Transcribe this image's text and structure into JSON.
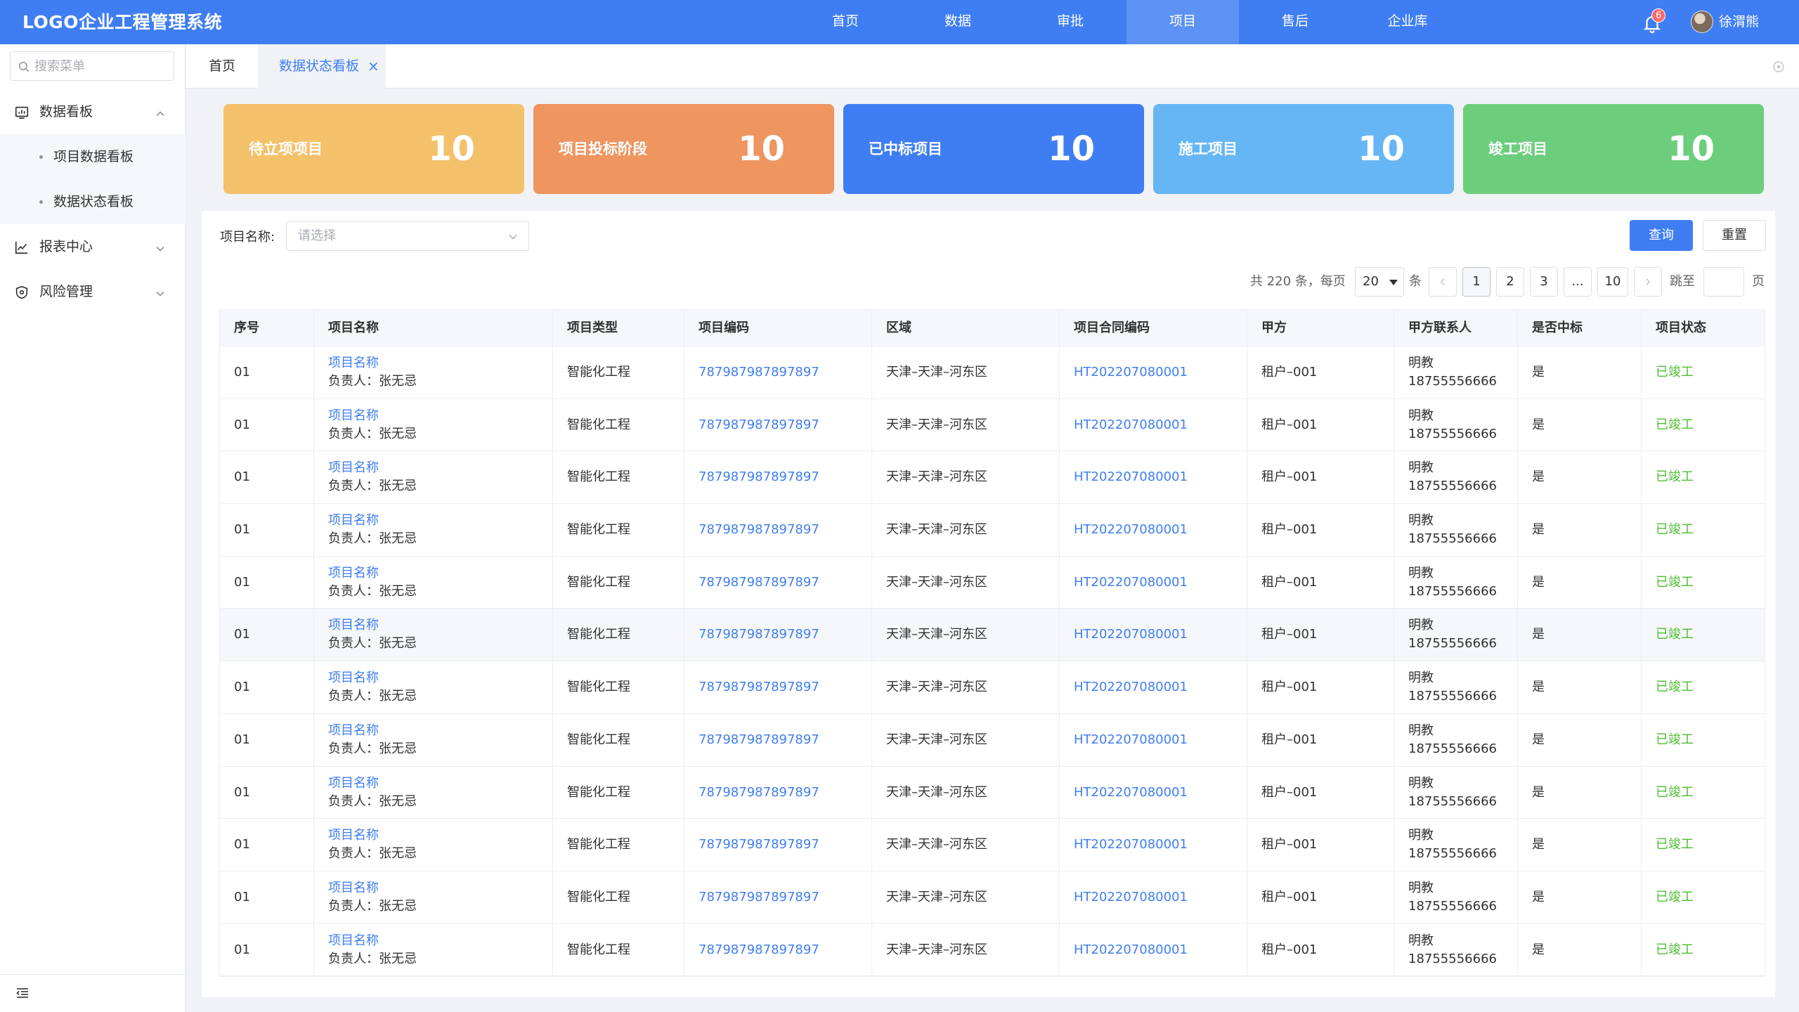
{
  "app": {
    "title": "LOGO企业工程管理系统"
  },
  "top_nav": [
    "首页",
    "数据",
    "审批",
    "项目",
    "售后",
    "企业库"
  ],
  "notifications": {
    "count": "6"
  },
  "user": {
    "name": "徐渭熊"
  },
  "sidebar": {
    "search_placeholder": "搜索菜单",
    "groups": [
      {
        "label": "数据看板",
        "icon": "dashboard-icon",
        "expanded": true,
        "children": [
          "项目数据看板",
          "数据状态看板"
        ]
      },
      {
        "label": "报表中心",
        "icon": "chart-icon",
        "expanded": false
      },
      {
        "label": "风险管理",
        "icon": "shield-icon",
        "expanded": false
      }
    ]
  },
  "tabs": {
    "home": "首页",
    "active": "数据状态看板",
    "close": "×"
  },
  "stats": [
    {
      "label": "待立项项目",
      "value": "10",
      "color": "#f4c16b"
    },
    {
      "label": "项目投标阶段",
      "value": "10",
      "color": "#ee9560"
    },
    {
      "label": "已中标项目",
      "value": "10",
      "color": "#3f7ef2"
    },
    {
      "label": "施工项目",
      "value": "10",
      "color": "#66b6f5"
    },
    {
      "label": "竣工项目",
      "value": "10",
      "color": "#6ccd7d"
    }
  ],
  "filter": {
    "label": "项目名称:",
    "placeholder": "请选择",
    "query_button": "查询",
    "reset_button": "重置"
  },
  "pagination": {
    "total_text": "共 220 条，每页",
    "page_size": "20",
    "unit": "条",
    "pages": [
      "1",
      "2",
      "3",
      "...",
      "10"
    ],
    "current_page": "1",
    "jump_label": "跳至",
    "page_label": "页"
  },
  "table": {
    "columns": [
      "序号",
      "项目名称",
      "项目类型",
      "项目编码",
      "区域",
      "项目合同编码",
      "甲方",
      "甲方联系人",
      "是否中标",
      "项目状态"
    ],
    "rows": [
      {
        "no": "01",
        "name": "项目名称",
        "owner": "负责人：张无忌",
        "type": "智能化工程",
        "code": "787987987897897",
        "region": "天津–天津–河东区",
        "contract": "HT202207080001",
        "party": "租户–001",
        "contact": "明教",
        "phone": "18755556666",
        "won": "是",
        "status": "已竣工"
      },
      {
        "no": "01",
        "name": "项目名称",
        "owner": "负责人：张无忌",
        "type": "智能化工程",
        "code": "787987987897897",
        "region": "天津–天津–河东区",
        "contract": "HT202207080001",
        "party": "租户–001",
        "contact": "明教",
        "phone": "18755556666",
        "won": "是",
        "status": "已竣工"
      },
      {
        "no": "01",
        "name": "项目名称",
        "owner": "负责人：张无忌",
        "type": "智能化工程",
        "code": "787987987897897",
        "region": "天津–天津–河东区",
        "contract": "HT202207080001",
        "party": "租户–001",
        "contact": "明教",
        "phone": "18755556666",
        "won": "是",
        "status": "已竣工"
      },
      {
        "no": "01",
        "name": "项目名称",
        "owner": "负责人：张无忌",
        "type": "智能化工程",
        "code": "787987987897897",
        "region": "天津–天津–河东区",
        "contract": "HT202207080001",
        "party": "租户–001",
        "contact": "明教",
        "phone": "18755556666",
        "won": "是",
        "status": "已竣工"
      },
      {
        "no": "01",
        "name": "项目名称",
        "owner": "负责人：张无忌",
        "type": "智能化工程",
        "code": "787987987897897",
        "region": "天津–天津–河东区",
        "contract": "HT202207080001",
        "party": "租户–001",
        "contact": "明教",
        "phone": "18755556666",
        "won": "是",
        "status": "已竣工"
      },
      {
        "no": "01",
        "name": "项目名称",
        "owner": "负责人：张无忌",
        "type": "智能化工程",
        "code": "787987987897897",
        "region": "天津–天津–河东区",
        "contract": "HT202207080001",
        "party": "租户–001",
        "contact": "明教",
        "phone": "18755556666",
        "won": "是",
        "status": "已竣工",
        "highlighted": true
      },
      {
        "no": "01",
        "name": "项目名称",
        "owner": "负责人：张无忌",
        "type": "智能化工程",
        "code": "787987987897897",
        "region": "天津–天津–河东区",
        "contract": "HT202207080001",
        "party": "租户–001",
        "contact": "明教",
        "phone": "18755556666",
        "won": "是",
        "status": "已竣工"
      },
      {
        "no": "01",
        "name": "项目名称",
        "owner": "负责人：张无忌",
        "type": "智能化工程",
        "code": "787987987897897",
        "region": "天津–天津–河东区",
        "contract": "HT202207080001",
        "party": "租户–001",
        "contact": "明教",
        "phone": "18755556666",
        "won": "是",
        "status": "已竣工"
      },
      {
        "no": "01",
        "name": "项目名称",
        "owner": "负责人：张无忌",
        "type": "智能化工程",
        "code": "787987987897897",
        "region": "天津–天津–河东区",
        "contract": "HT202207080001",
        "party": "租户–001",
        "contact": "明教",
        "phone": "18755556666",
        "won": "是",
        "status": "已竣工"
      },
      {
        "no": "01",
        "name": "项目名称",
        "owner": "负责人：张无忌",
        "type": "智能化工程",
        "code": "787987987897897",
        "region": "天津–天津–河东区",
        "contract": "HT202207080001",
        "party": "租户–001",
        "contact": "明教",
        "phone": "18755556666",
        "won": "是",
        "status": "已竣工"
      },
      {
        "no": "01",
        "name": "项目名称",
        "owner": "负责人：张无忌",
        "type": "智能化工程",
        "code": "787987987897897",
        "region": "天津–天津–河东区",
        "contract": "HT202207080001",
        "party": "租户–001",
        "contact": "明教",
        "phone": "18755556666",
        "won": "是",
        "status": "已竣工"
      },
      {
        "no": "01",
        "name": "项目名称",
        "owner": "负责人：张无忌",
        "type": "智能化工程",
        "code": "787987987897897",
        "region": "天津–天津–河东区",
        "contract": "HT202207080001",
        "party": "租户–001",
        "contact": "明教",
        "phone": "18755556666",
        "won": "是",
        "status": "已竣工"
      }
    ]
  }
}
